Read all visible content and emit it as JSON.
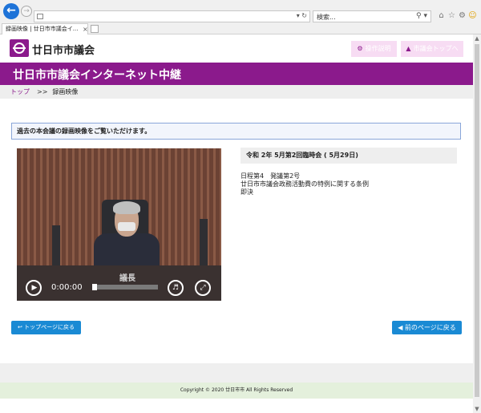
{
  "browser": {
    "back_icon": "back-arrow-icon",
    "forward_icon": "forward-arrow-icon",
    "url_tools": "▾ ↻",
    "search_placeholder": "検索...",
    "search_icon_glyph": "⚲ ▾",
    "tab_title": "録画映像 | 廿日市市議会イ...",
    "tab_close": "×"
  },
  "header": {
    "site_name": "廿日市市議会",
    "btn_help": "操作説明",
    "btn_home": "市議会トップへ"
  },
  "title_band": "廿日市市議会インターネット中継",
  "breadcrumb": {
    "home": "トップ",
    "separator": ">>",
    "current": "録画映像"
  },
  "notice": "過去の本会議の録画映像をご覧いただけます。",
  "video": {
    "plate": "議長",
    "time": "0:00:00",
    "progress": 0
  },
  "meeting": {
    "title": "令和 2年 5月第2回臨時会 ( 5月29日)",
    "line1": "日程第4　発議第2号",
    "line2": "廿日市市議会政務活動費の特例に関する条例",
    "line3": "即決"
  },
  "buttons": {
    "top_page": "トップページに戻る",
    "prev_page": "前のページに戻る"
  },
  "footer": "Copyright © 2020 廿日市市 All Rights Reserved",
  "colors": {
    "brand": "#8b1a8c",
    "button": "#1a8ad4",
    "footer_bg": "#e4f0dc"
  }
}
